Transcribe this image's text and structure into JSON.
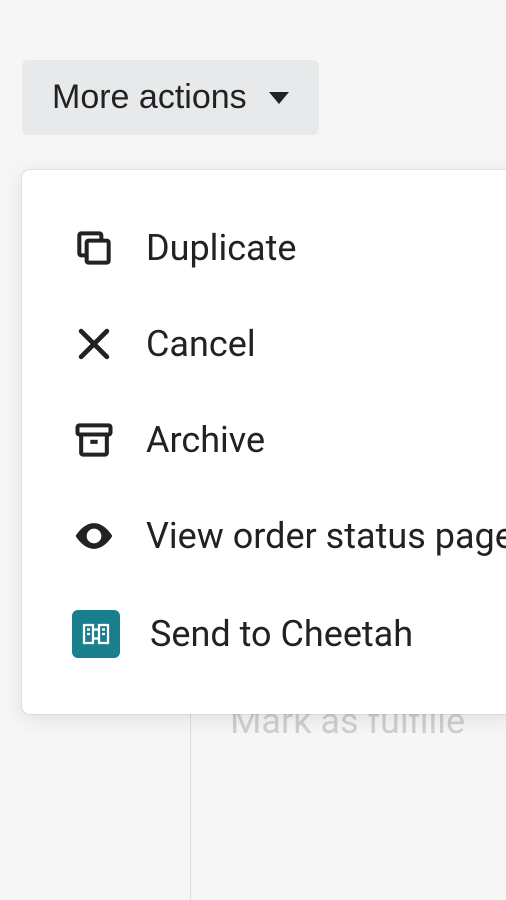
{
  "button": {
    "label": "More actions"
  },
  "menu": {
    "items": [
      {
        "icon": "duplicate-icon",
        "label": "Duplicate"
      },
      {
        "icon": "cancel-icon",
        "label": "Cancel"
      },
      {
        "icon": "archive-icon",
        "label": "Archive"
      },
      {
        "icon": "eye-icon",
        "label": "View order status page"
      },
      {
        "icon": "cheetah-app-icon",
        "label": "Send to Cheetah"
      }
    ]
  },
  "background": {
    "hint_text": "Mark as fulfille"
  }
}
